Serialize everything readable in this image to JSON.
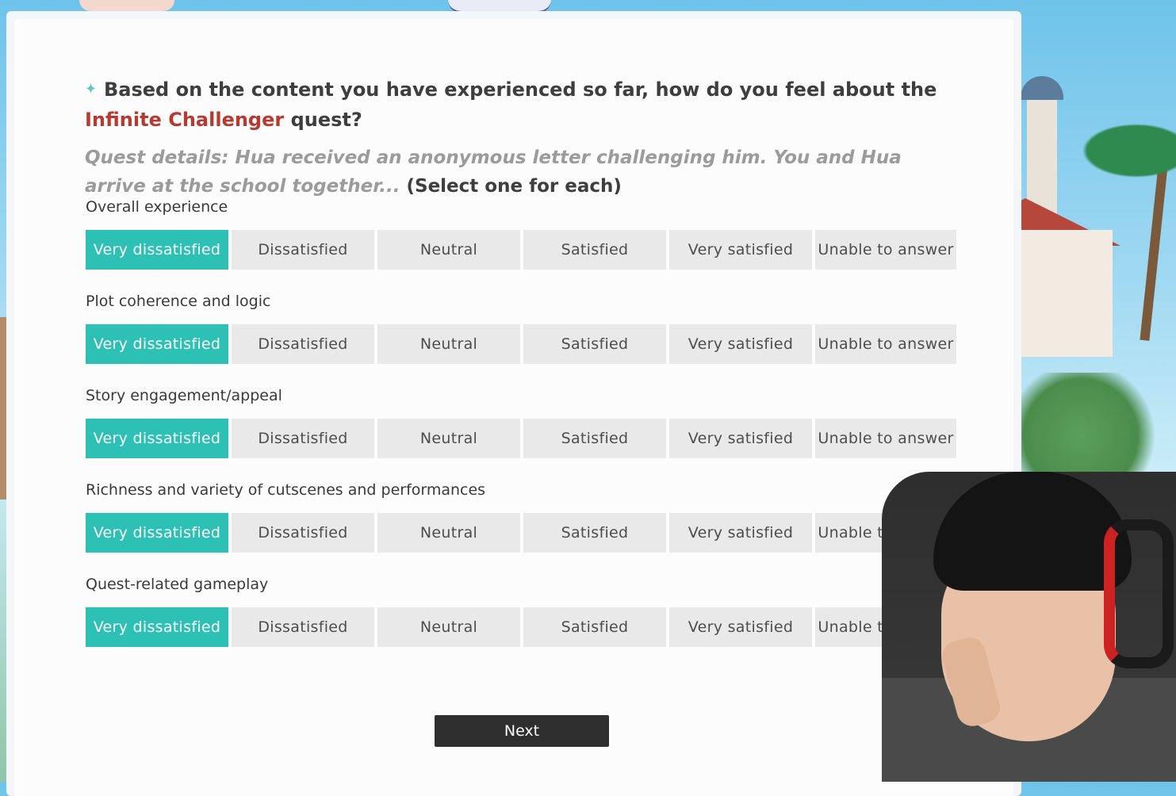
{
  "question": {
    "prefix": "Based on the content you have experienced so far, how do you feel about the ",
    "highlight": "Infinite Challenger",
    "suffix": " quest?",
    "details": "Quest details: Hua received an anonymous letter challenging him. You and Hua arrive at the school together...",
    "select_note": "(Select one for each)",
    "icon": "sparkle-icon"
  },
  "option_labels": [
    "Very dissatisfied",
    "Dissatisfied",
    "Neutral",
    "Satisfied",
    "Very satisfied",
    "Unable to answer"
  ],
  "rows": [
    {
      "label": "Overall experience",
      "selected": "Very dissatisfied"
    },
    {
      "label": "Plot coherence and logic",
      "selected": "Very dissatisfied"
    },
    {
      "label": "Story engagement/appeal",
      "selected": "Very dissatisfied"
    },
    {
      "label": "Richness and variety of cutscenes and performances",
      "selected": "Very dissatisfied"
    },
    {
      "label": "Quest-related gameplay",
      "selected": "Very dissatisfied"
    }
  ],
  "next_label": "Next",
  "colors": {
    "selected": "#2dc0b4",
    "highlight": "#b8392e",
    "button_dark": "#2f2f2f"
  }
}
